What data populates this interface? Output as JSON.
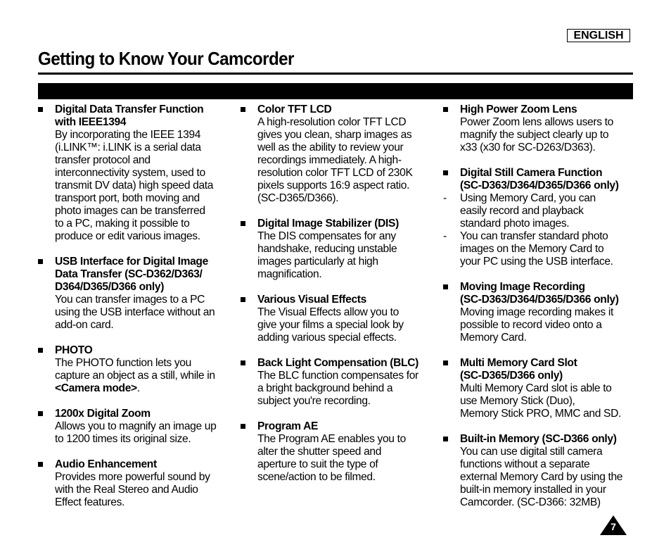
{
  "header": {
    "language": "ENGLISH",
    "title": "Getting to Know Your Camcorder"
  },
  "columns": [
    {
      "items": [
        {
          "heading": "Digital Data Transfer Function\nwith IEEE1394",
          "body": "By incorporating the IEEE 1394\n(i.LINK™: i.LINK is a serial data\ntransfer protocol and\ninterconnectivity system, used to\ntransmit DV data) high speed data\ntransport port, both moving and\nphoto images can be transferred\nto a PC, making it possible to\nproduce or edit various images."
        },
        {
          "heading": "USB Interface for Digital Image\nData Transfer (SC-D362/D363/\nD364/D365/D366 only)",
          "body": "You can transfer images to a PC\nusing the USB interface without an\nadd-on card."
        },
        {
          "heading": "PHOTO",
          "body": "The PHOTO function lets you\ncapture an object as a still, while in",
          "body_bold": "<Camera mode>",
          "body_tail": "."
        },
        {
          "heading": "1200x Digital Zoom",
          "body": "Allows you to magnify an image up\nto 1200 times its original size."
        },
        {
          "heading": "Audio Enhancement",
          "body": "Provides more powerful sound by\nwith the Real Stereo and Audio\nEffect features."
        }
      ]
    },
    {
      "items": [
        {
          "heading": "Color TFT LCD",
          "body": "A high-resolution color TFT LCD\ngives you clean, sharp images as\nwell as the ability to review your\nrecordings immediately. A high-\nresolution color TFT LCD of 230K\npixels supports 16:9 aspect ratio.\n(SC-D365/D366)."
        },
        {
          "heading": "Digital Image Stabilizer (DIS)",
          "body": "The DIS compensates for any\nhandshake, reducing unstable\nimages particularly at high\nmagnification."
        },
        {
          "heading": "Various Visual Effects",
          "body": "The Visual Effects allow you to\ngive your films a special look by\nadding various special effects."
        },
        {
          "heading": "Back Light Compensation (BLC)",
          "body": "The BLC function compensates for\na bright background behind a\nsubject you're recording."
        },
        {
          "heading": "Program AE",
          "body": "The Program AE enables you to\nalter the shutter speed and\naperture to suit the type of\nscene/action to be filmed."
        }
      ]
    },
    {
      "items": [
        {
          "heading": "High Power Zoom Lens",
          "body": "Power Zoom lens allows users to\nmagnify the subject clearly up to\nx33 (x30 for SC-D263/D363)."
        },
        {
          "heading": "Digital Still Camera Function\n(SC-D363/D364/D365/D366 only)",
          "dash_items": [
            "Using Memory Card, you can\neasily record and playback\nstandard photo images.",
            "You can transfer standard photo\nimages on the Memory Card to\nyour PC using the USB interface."
          ]
        },
        {
          "heading": "Moving Image Recording\n(SC-D363/D364/D365/D366 only)",
          "body": "Moving image recording makes it\npossible to record video onto a\nMemory Card."
        },
        {
          "heading": "Multi Memory Card Slot\n(SC-D365/D366 only)",
          "body": "Multi Memory Card slot is able to\nuse Memory Stick (Duo),\nMemory Stick PRO, MMC and SD."
        },
        {
          "heading": "Built-in Memory (SC-D366 only)",
          "body": "You can use digital still camera\nfunctions without a separate\nexternal Memory Card by using the\nbuilt-in memory installed in your\nCamcorder. (SC-D366: 32MB)"
        }
      ]
    }
  ],
  "footer": {
    "page_number": "7"
  }
}
